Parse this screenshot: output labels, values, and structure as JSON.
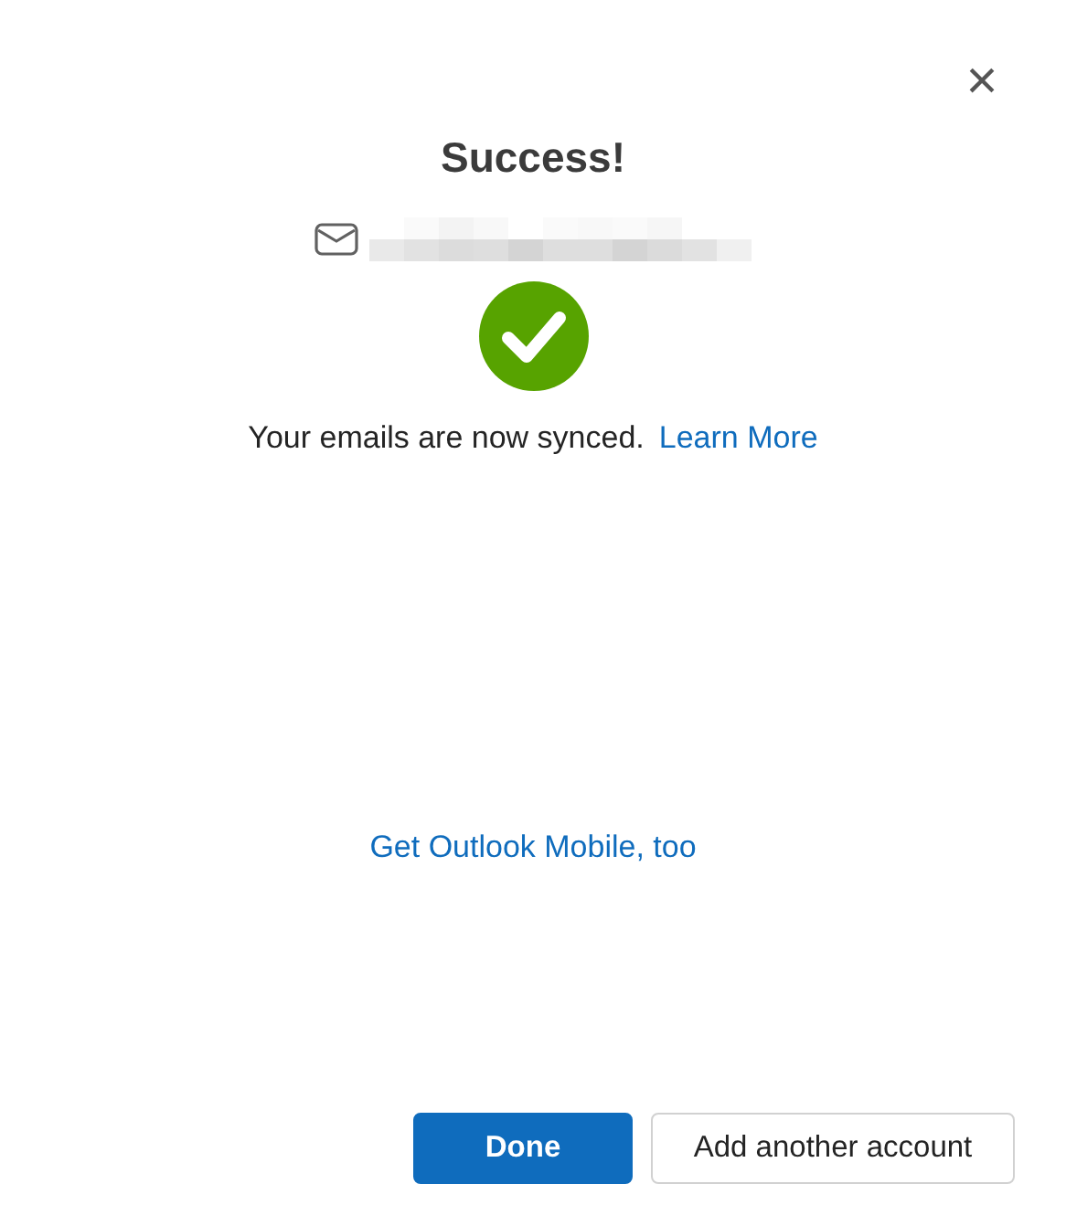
{
  "dialog": {
    "title": "Success!",
    "close": "×"
  },
  "account": {
    "address_hidden": true
  },
  "status": {
    "kind": "success"
  },
  "message": {
    "text": "Your emails are now synced.",
    "link": "Learn More"
  },
  "mobile_link": "Get Outlook Mobile, too",
  "buttons": [
    {
      "label": "Done",
      "kind": "primary"
    },
    {
      "label": "Add another account",
      "kind": "secondary"
    }
  ]
}
